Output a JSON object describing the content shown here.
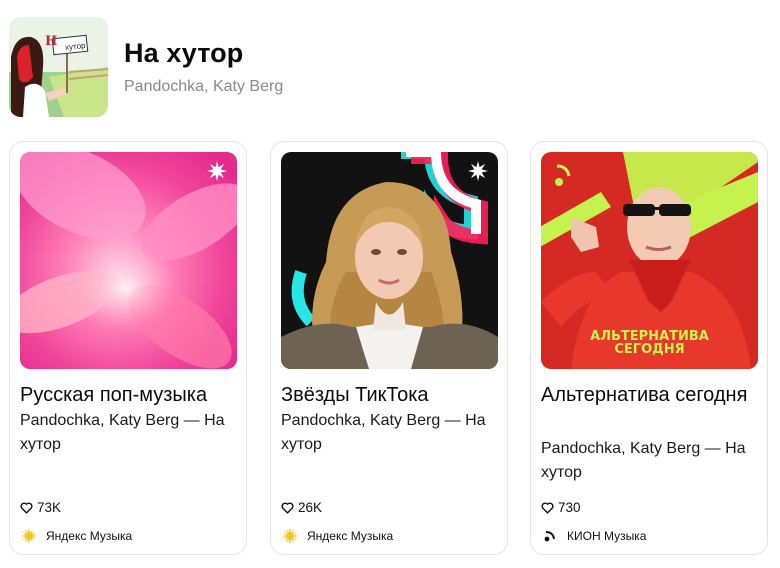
{
  "track": {
    "title": "На хутор",
    "artists": "Pandochka, Katy Berg",
    "cover_sign": "Н",
    "cover_sign2": "хутор"
  },
  "playlists": [
    {
      "title": "Русская поп-музыка",
      "subtitle": "Pandochka, Katy Berg — На хутор",
      "likes": "73K",
      "source": "Яндекс Музыка",
      "source_icon": "yandex-music-icon"
    },
    {
      "title": "Звёзды ТикТока",
      "subtitle": "Pandochka, Katy Berg — На хутор",
      "likes": "26K",
      "source": "Яндекс Музыка",
      "source_icon": "yandex-music-icon"
    },
    {
      "title": "Альтернатива сегодня",
      "subtitle": "Pandochka, Katy Berg — На хутор",
      "likes": "730",
      "source": "КИОН Музыка",
      "source_icon": "kion-music-icon",
      "cover_text_1": "АЛЬТЕРНАТИВА",
      "cover_text_2": "СЕГОДНЯ"
    }
  ],
  "colors": {
    "yandex_sun": "#f8c21b",
    "text_secondary": "#8a8a8a",
    "alt_red": "#d42a23",
    "alt_green": "#c6f24e"
  }
}
